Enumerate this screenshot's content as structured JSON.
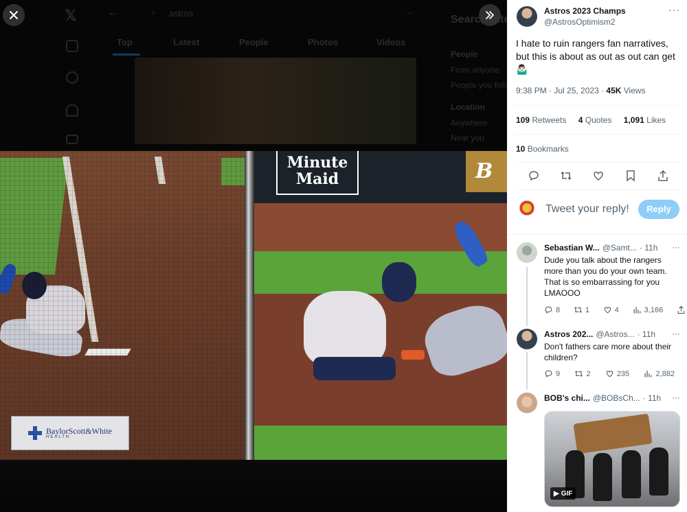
{
  "background": {
    "search_query": "astros",
    "tabs": [
      "Top",
      "Latest",
      "People",
      "Photos",
      "Videos"
    ],
    "search_filters_title": "Search filters",
    "filters": [
      "People",
      "From anyone",
      "People you follow",
      "Location",
      "Anywhere",
      "Near you"
    ]
  },
  "photo": {
    "sign_text": "Minute Maid",
    "gold_sign_letter": "B",
    "sponsor_name": "BaylorScott&White",
    "sponsor_sub": "HEALTH"
  },
  "tweet": {
    "author_name": "Astros 2023 Champs",
    "author_handle": "@AstrosOptimism2",
    "more": "···",
    "text": "I hate to ruin rangers fan narratives, but this is about as out as out can get 🤷🏻‍♂️",
    "time": "9:38 PM · Jul 25, 2023 · ",
    "views_count": "45K",
    "views_label": " Views",
    "retweets_count": "109",
    "retweets_label": " Retweets",
    "quotes_count": "4",
    "quotes_label": " Quotes",
    "likes_count": "1,091",
    "likes_label": " Likes",
    "bookmarks_count": "10",
    "bookmarks_label": " Bookmarks"
  },
  "reply_box": {
    "placeholder": "Tweet your reply!",
    "button_label": "Reply"
  },
  "replies": [
    {
      "name": "Sebastian W...",
      "handle": "@Samt...",
      "time": "· 11h",
      "text": "Dude you talk about the rangers more than you do your own team. That is so embarrassing for you LMAOOO",
      "replies": "8",
      "retweets": "1",
      "likes": "4",
      "views": "3,166"
    },
    {
      "name": "Astros 202...",
      "handle": "@Astros...",
      "time": "· 11h",
      "text": "Don't fathers care more about their children?",
      "replies": "9",
      "retweets": "2",
      "likes": "235",
      "views": "2,882"
    },
    {
      "name": "BOB's chi...",
      "handle": "@BOBsCh...",
      "time": "· 11h",
      "gif_label": "GIF"
    }
  ],
  "colors": {
    "accent": "#1d9bf0",
    "reply_button": "#8ecdf8",
    "muted_text": "#536471"
  }
}
